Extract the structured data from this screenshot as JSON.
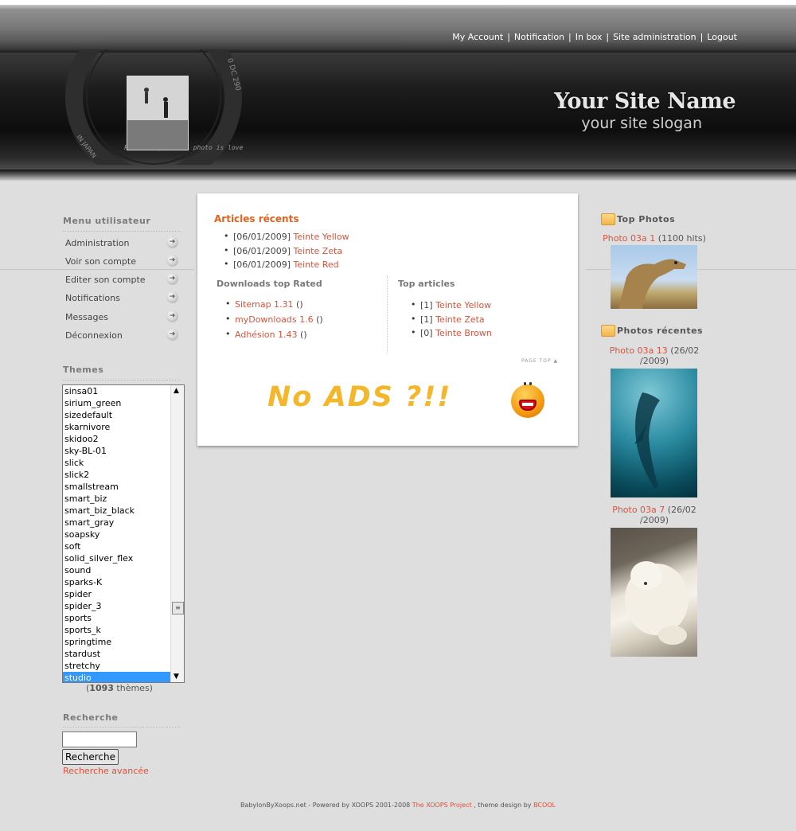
{
  "topnav": {
    "items": [
      "My Account",
      "Notification",
      "In box",
      "Site administration",
      "Logout"
    ],
    "separator": "|"
  },
  "header": {
    "site_name": "Your Site Name",
    "slogan": "your site slogan",
    "lens_text_left": "Photo is power... photo is love",
    "lens_text_ring": "IN JAPAN",
    "lens_text_code": "0 DC 290"
  },
  "user_menu": {
    "title": "Menu utilisateur",
    "items": [
      "Administration",
      "Voir son compte",
      "Editer son compte",
      "Notifications",
      "Messages",
      "Déconnexion"
    ],
    "arrow_icon": "circle-arrow-icon"
  },
  "themes": {
    "title": "Themes",
    "options": [
      "sinsa01",
      "sirium_green",
      "sizedefault",
      "skarnivore",
      "skidoo2",
      "sky-BL-01",
      "slick",
      "slick2",
      "smallstream",
      "smart_biz",
      "smart_biz_black",
      "smart_gray",
      "soapsky",
      "soft",
      "solid_silver_flex",
      "sound",
      "sparks-K",
      "spider",
      "spider_3",
      "sports",
      "sports_k",
      "springtime",
      "stardust",
      "stretchy",
      "studio"
    ],
    "selected": "studio",
    "count_prefix": "(",
    "count": "1093",
    "count_suffix": " thèmes)"
  },
  "search": {
    "title": "Recherche",
    "input_value": "",
    "button_label": "Recherche",
    "advanced_link": "Recherche avancée"
  },
  "center": {
    "recent_articles_title": "Articles récents",
    "recent_articles": [
      {
        "date": "[06/01/2009]",
        "title": "Teinte Yellow"
      },
      {
        "date": "[06/01/2009]",
        "title": "Teinte Zeta"
      },
      {
        "date": "[06/01/2009]",
        "title": "Teinte Red"
      }
    ],
    "downloads_title": "Downloads top Rated",
    "downloads": [
      {
        "name": "Sitemap 1.31",
        "suffix": " ()"
      },
      {
        "name": "myDownloads 1.6",
        "suffix": " ()"
      },
      {
        "name": "Adhésion 1.43",
        "suffix": " ()"
      }
    ],
    "top_articles_title": "Top articles",
    "top_articles": [
      {
        "rank": "[1]",
        "title": "Teinte Yellow"
      },
      {
        "rank": "[1]",
        "title": "Teinte Zeta"
      },
      {
        "rank": "[0]",
        "title": "Teinte Brown"
      }
    ],
    "page_top_label": "PAGE TOP",
    "ad_text": "No ADS ?!!"
  },
  "right": {
    "top_photos_title": "Top Photos",
    "top_photo_link": "Photo 03a 1",
    "top_photo_hits": " (1100 hits)",
    "recent_photos_title": "Photos récentes",
    "recent_photos": [
      {
        "link": "Photo 03a 13",
        "date_a": " (26/02",
        "date_b": "/2009)"
      },
      {
        "link": "Photo 03a 7",
        "date_a": " (26/02",
        "date_b": "/2009)"
      }
    ]
  },
  "footer": {
    "text_a": "BabylonByXoops.net - Powered by XOOPS 2001-2008 ",
    "link_a": "The XOOPS Project",
    "text_b": " , theme design by ",
    "link_b": "BCOOL"
  },
  "colors": {
    "link": "#d9533c",
    "section_title": "#e3621d",
    "selection": "#3399ff",
    "ad_text": "#f5b72a"
  }
}
